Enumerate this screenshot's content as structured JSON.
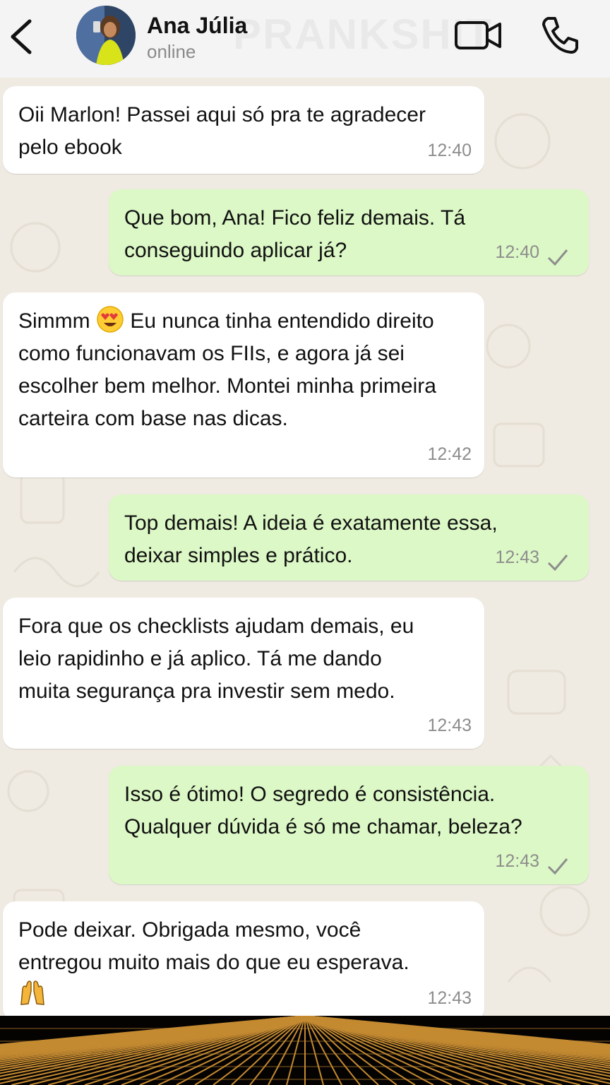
{
  "header": {
    "contact_name": "Ana Júlia",
    "status": "online",
    "watermark": "PRANKSHIT",
    "icons": [
      "back-arrow-icon",
      "video-call-icon",
      "phone-call-icon"
    ]
  },
  "messages": [
    {
      "direction": "in",
      "text": "Oii Marlon! Passei aqui só pra te agradecer pelo ebook",
      "time": "12:40"
    },
    {
      "direction": "out",
      "text": "Que bom, Ana! Fico feliz demais. Tá conseguindo aplicar já?",
      "time": "12:40",
      "status": "sent"
    },
    {
      "direction": "in",
      "text_before_emoji": "Simmm",
      "emoji": "heart-eyes-emoji",
      "text_after_emoji": "Eu nunca tinha entendido direito como funcionavam os FIIs, e agora já sei escolher bem melhor. Montei minha primeira carteira com base nas dicas.",
      "time": "12:42"
    },
    {
      "direction": "out",
      "text": "Top demais! A ideia é exatamente essa, deixar simples e prático.",
      "time": "12:43",
      "status": "sent"
    },
    {
      "direction": "in",
      "text": "Fora que os checklists ajudam demais, eu leio rapidinho e já aplico. Tá me dando muita segurança pra investir sem medo.",
      "time": "12:43"
    },
    {
      "direction": "out",
      "text": "Isso é ótimo! O segredo é consistência. Qualquer dúvida é só me chamar, beleza?",
      "time": "12:43",
      "status": "sent"
    },
    {
      "direction": "in",
      "text": "Pode deixar. Obrigada mesmo, você entregou muito mais do que eu esperava.",
      "emoji": "raised-hands-emoji",
      "time": "12:43"
    }
  ],
  "colors": {
    "background": "#efeae2",
    "incoming_bubble": "#ffffff",
    "outgoing_bubble": "#dcf8c6",
    "header": "#f4f4f4",
    "time_text": "#8d8d8d",
    "rays_gold": "#e6a23a"
  }
}
